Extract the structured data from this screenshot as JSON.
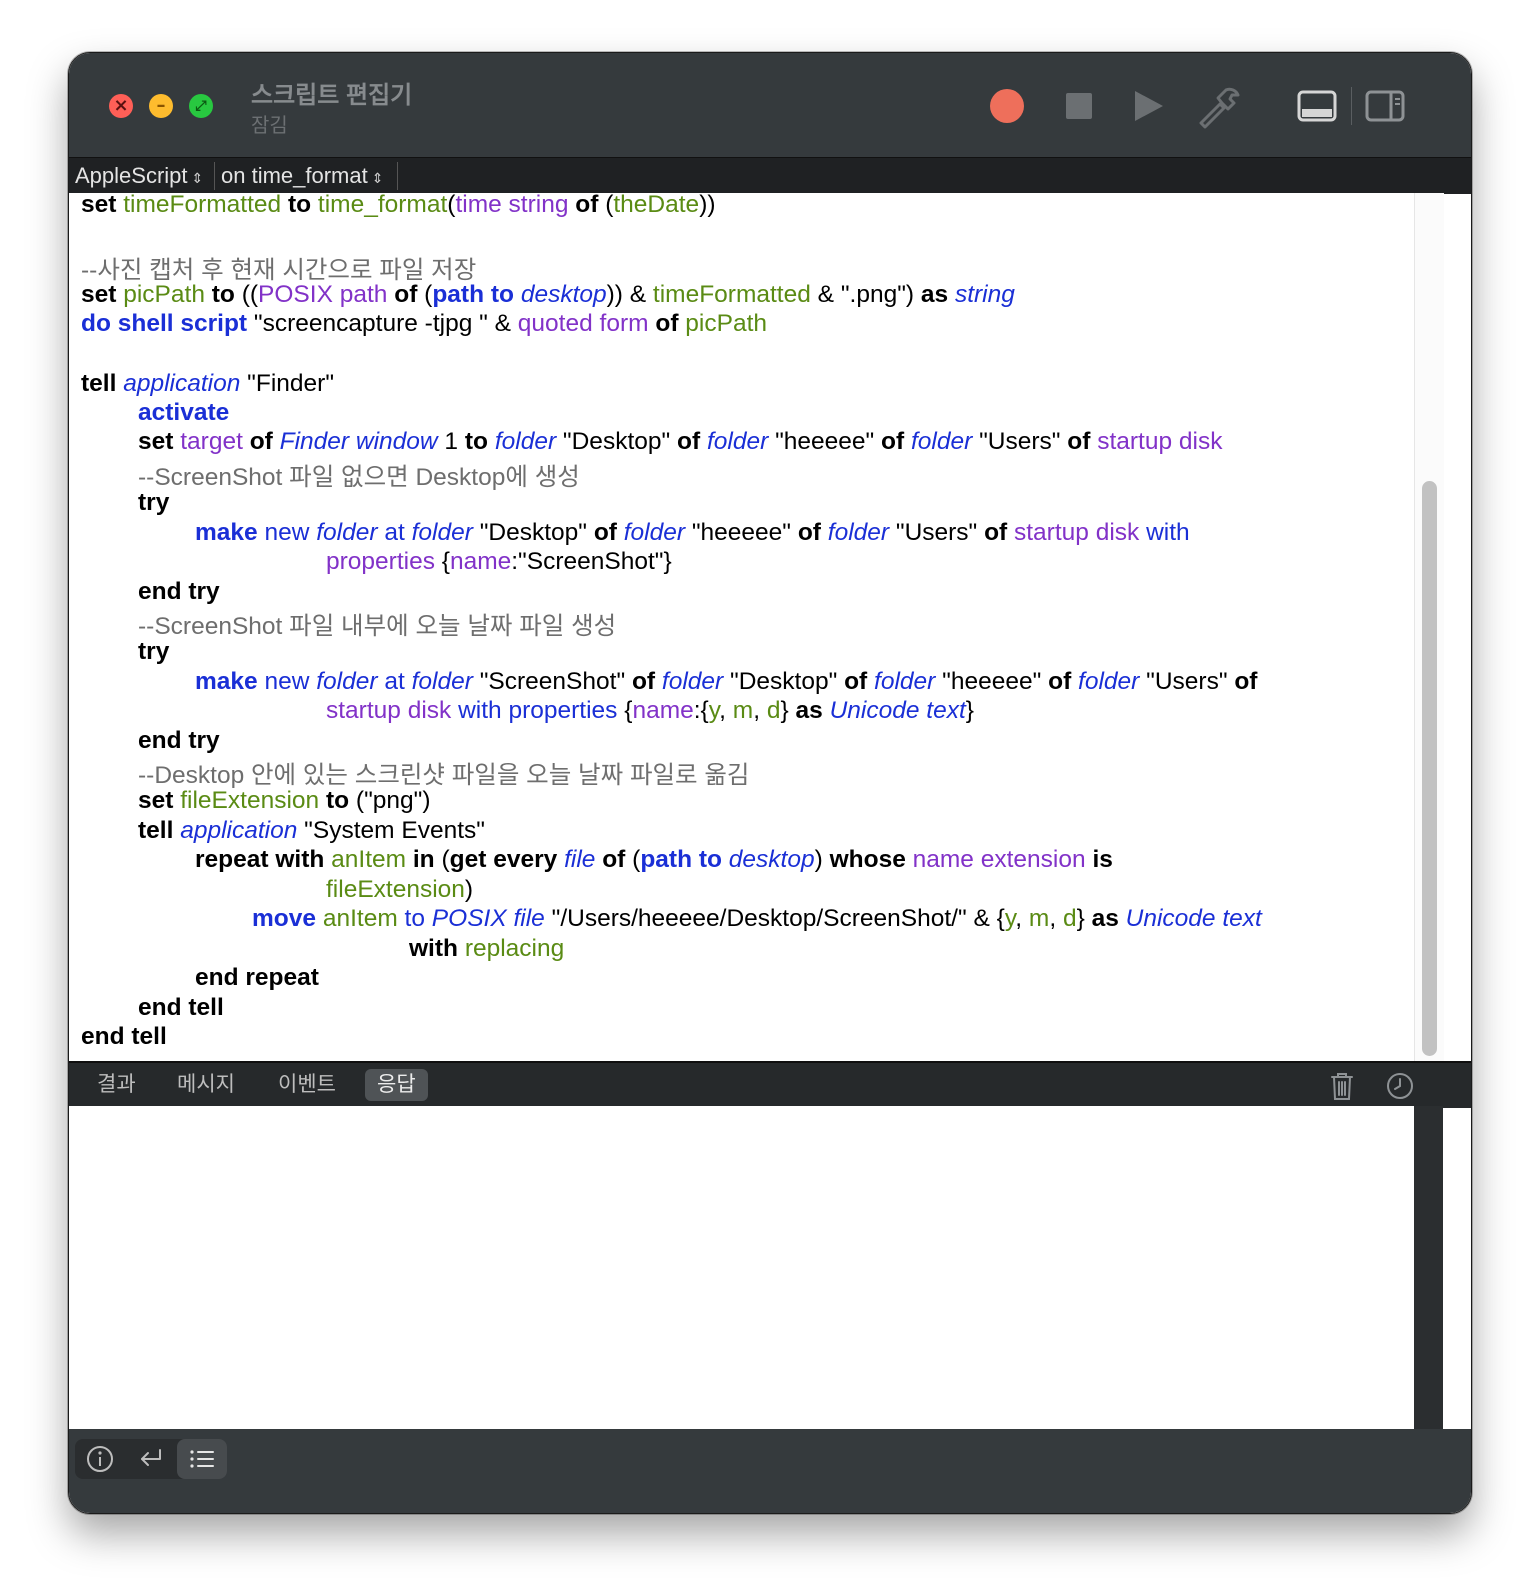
{
  "window": {
    "title": "스크립트 편집기",
    "subtitle": "잠김"
  },
  "toolbar": {
    "record": "record-button",
    "stop": "stop-button",
    "run": "run-button",
    "compile": "hammer-icon",
    "show_log": "bottom-pane-icon",
    "show_side": "side-pane-icon",
    "record_color": "#ee6f5b"
  },
  "navigator": {
    "language": "AppleScript",
    "handler": "on time_format"
  },
  "code": {
    "l1": [
      "set",
      "timeFormatted",
      "to",
      "time_format",
      "(",
      "time string",
      "of",
      "(",
      "theDate",
      "))"
    ],
    "l3": [
      "--사진 캡처 후 현재 시간으로 파일 저장"
    ],
    "l4": [
      "set",
      "picPath",
      "to",
      "((",
      "POSIX path",
      "of",
      "(",
      "path to",
      "desktop",
      "))",
      "&",
      "timeFormatted",
      "& \".png\")",
      "as",
      "string"
    ],
    "l5": [
      "do shell script",
      "\"screencapture -tjpg \" &",
      "quoted form",
      "of",
      "picPath"
    ],
    "l7": [
      "tell",
      "application",
      "\"Finder\""
    ],
    "l8": [
      "activate"
    ],
    "l9": [
      "set",
      "target",
      "of",
      "Finder window",
      "1",
      "to",
      "folder",
      "\"Desktop\"",
      "of",
      "folder",
      "\"heeeee\"",
      "of",
      "folder",
      "\"Users\"",
      "of",
      "startup disk"
    ],
    "l10": [
      "--ScreenShot 파일 없으면 Desktop에 생성"
    ],
    "l11": [
      "try"
    ],
    "l12": [
      "make",
      "new",
      "folder",
      "at",
      "folder",
      "\"Desktop\"",
      "of",
      "folder",
      "\"heeeee\"",
      "of",
      "folder",
      "\"Users\"",
      "of",
      "startup disk",
      "with"
    ],
    "l13": [
      "properties",
      "{",
      "name",
      ":\"ScreenShot\"}"
    ],
    "l14": [
      "end try"
    ],
    "l15": [
      "--ScreenShot 파일 내부에 오늘 날짜 파일 생성"
    ],
    "l16": [
      "try"
    ],
    "l17": [
      "make",
      "new",
      "folder",
      "at",
      "folder",
      "\"ScreenShot\"",
      "of",
      "folder",
      "\"Desktop\"",
      "of",
      "folder",
      "\"heeeee\"",
      "of",
      "folder",
      "\"Users\"",
      "of"
    ],
    "l18": [
      "startup disk",
      "with",
      "properties",
      "{",
      "name",
      ":{",
      "y",
      ",",
      "m",
      ",",
      "d",
      "}",
      "as",
      "Unicode text",
      "}"
    ],
    "l19": [
      "end try"
    ],
    "l20": [
      "--Desktop 안에 있는 스크린샷 파일을 오늘 날짜 파일로 옮김"
    ],
    "l21": [
      "set",
      "fileExtension",
      "to",
      "(\"png\")"
    ],
    "l22": [
      "tell",
      "application",
      "\"System Events\""
    ],
    "l23": [
      "repeat with",
      "anItem",
      "in",
      "(",
      "get every",
      "file",
      "of",
      "(",
      "path to",
      "desktop",
      ")",
      "whose",
      "name extension",
      "is"
    ],
    "l24": [
      "fileExtension",
      ")"
    ],
    "l25": [
      "move",
      "anItem",
      "to",
      "POSIX file",
      "\"/Users/heeeee/Desktop/ScreenShot/\" & {",
      "y",
      ",",
      "m",
      ",",
      "d",
      "}",
      "as",
      "Unicode text"
    ],
    "l26": [
      "with",
      "replacing"
    ],
    "l27": [
      "end repeat"
    ],
    "l28": [
      "end tell"
    ],
    "l29": [
      "end tell"
    ]
  },
  "tabs": [
    "결과",
    "메시지",
    "이벤트",
    "응답"
  ],
  "active_tab": "응답",
  "tab_actions": {
    "clear": "trash-icon",
    "history": "clock-icon"
  },
  "bottom": {
    "description": "info-icon",
    "result": "return-arrow-icon",
    "log": "list-icon"
  }
}
